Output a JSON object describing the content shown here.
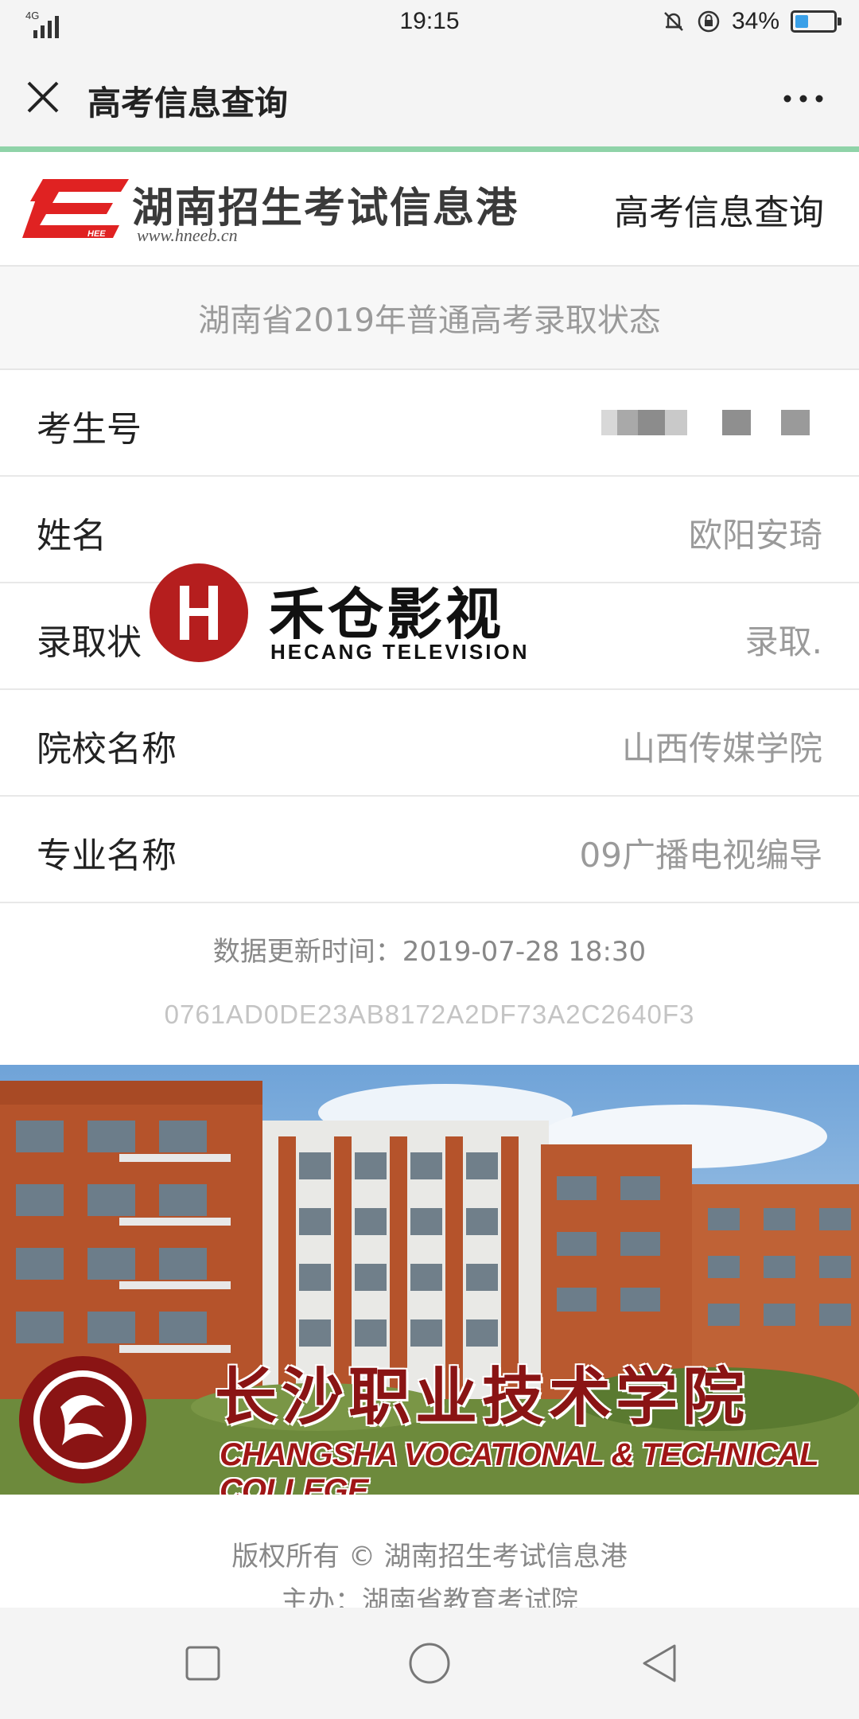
{
  "status_bar": {
    "network": "4G",
    "time": "19:15",
    "battery": "34%",
    "battery_level": 0.34
  },
  "nav": {
    "title": "高考信息查询"
  },
  "header": {
    "site_name": "湖南招生考试信息港",
    "site_url": "www.hneeb.cn",
    "link": "高考信息查询"
  },
  "page_title": "湖南省2019年普通高考录取状态",
  "rows": [
    {
      "label": "考生号",
      "value": ""
    },
    {
      "label": "姓名",
      "value": "欧阳安琦"
    },
    {
      "label": "录取状",
      "value": "录取."
    },
    {
      "label": "院校名称",
      "value": "山西传媒学院"
    },
    {
      "label": "专业名称",
      "value": "09广播电视编导"
    }
  ],
  "watermark": {
    "title": "禾仓影视",
    "subtitle": "HECANG TELEVISION"
  },
  "update_time": "数据更新时间：2019-07-28 18:30",
  "hash_code": "0761AD0DE23AB8172A2DF73A2C2640F3",
  "banner": {
    "title": "长沙职业技术学院",
    "subtitle": "CHANGSHA VOCATIONAL & TECHNICAL COLLEGE"
  },
  "copyright": "版权所有 © 湖南招生考试信息港",
  "organizer": "主办：湖南省教育考试院",
  "colors": {
    "brand_red": "#e02222",
    "progress_green": "#8fd3a8",
    "watermark_red": "#b51e1e"
  },
  "icons": [
    "signal-icon",
    "bell-muted-icon",
    "rotation-lock-icon",
    "battery-icon",
    "close-icon",
    "more-icon",
    "hneeb-logo-icon",
    "square-recent-icon",
    "circle-home-icon",
    "triangle-back-icon"
  ]
}
